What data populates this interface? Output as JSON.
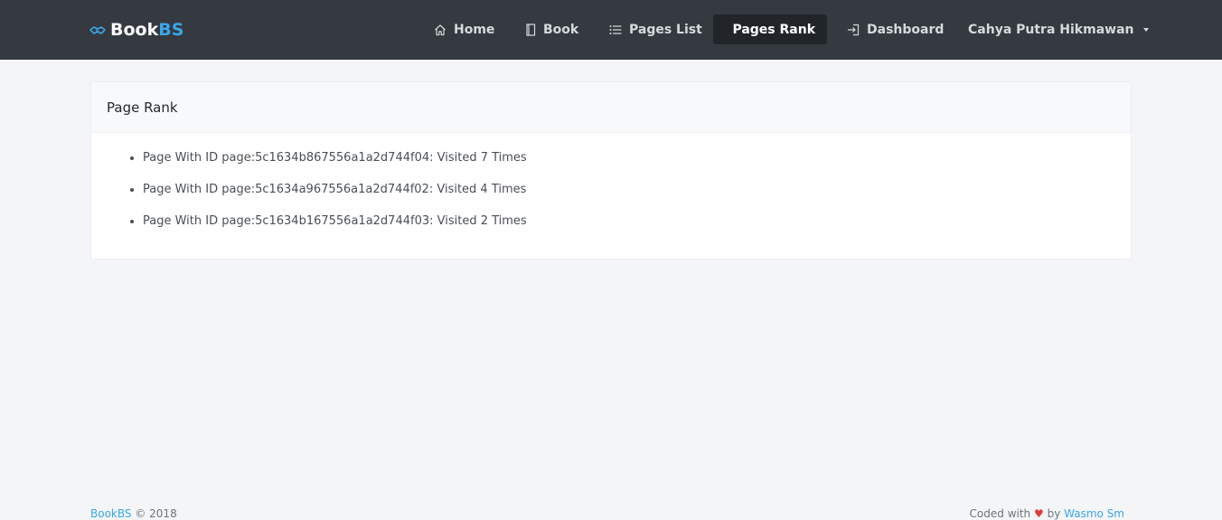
{
  "navbar": {
    "brand_main": "Book",
    "brand_accent": "BS",
    "brand_icon": "handshake-icon",
    "items": [
      {
        "label": "Home",
        "icon": "home-icon"
      },
      {
        "label": "Book",
        "icon": "book-icon"
      },
      {
        "label": "Pages List",
        "icon": "list-icon"
      },
      {
        "label": "Pages Rank",
        "icon": "trophy-icon",
        "active": true
      },
      {
        "label": "Dashboard",
        "icon": "sign-in-icon"
      }
    ],
    "user": {
      "name": "Cahya Putra Hikmawan",
      "icon": "caret-down-icon"
    }
  },
  "card": {
    "title": "Page Rank",
    "items": [
      "Page With ID page:5c1634b867556a1a2d744f04: Visited 7 Times",
      "Page With ID page:5c1634a967556a1a2d744f02: Visited 4 Times",
      "Page With ID page:5c1634b167556a1a2d744f03: Visited 2 Times"
    ]
  },
  "footer": {
    "brand_link": "BookBS",
    "copyright": "© 2018",
    "coded_with": "Coded with",
    "by": "by",
    "author_link": "Wasmo Sm"
  },
  "colors": {
    "navbar_bg": "#343a40",
    "active_bg": "#212529",
    "accent": "#3aa6e8",
    "page_bg": "#f4f5f7"
  }
}
